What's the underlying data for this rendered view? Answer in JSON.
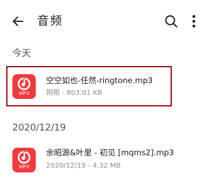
{
  "header": {
    "title": "音频",
    "back_icon": "arrow-left-icon",
    "search_icon": "search-icon",
    "more_icon": "more-vertical-icon"
  },
  "sections": [
    {
      "label": "今天",
      "files": [
        {
          "name": "空空如也-任然-ringtone.mp3",
          "meta": "刚刚 - 803.01 KB",
          "icon_label": "MP3",
          "highlighted": true
        }
      ]
    },
    {
      "label": "2020/12/19",
      "files": [
        {
          "name": "余昭源&叶里 - 初见 [mqms2].mp3",
          "meta": "2020/12/19 - 4.32 MB",
          "icon_label": "MP3",
          "highlighted": false
        }
      ]
    }
  ],
  "colors": {
    "icon_red": "#ef3b3e",
    "highlight_border": "#a41f22",
    "meta_text": "#8a8a8a"
  }
}
